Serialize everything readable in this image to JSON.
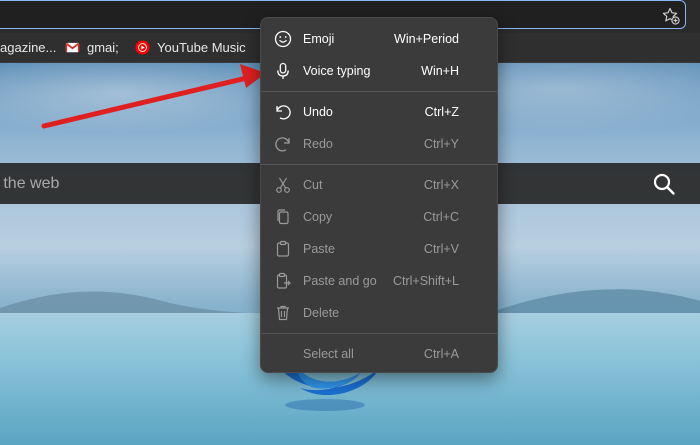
{
  "bookmarks": [
    {
      "label": "agazine...",
      "icon": "bookmark-icon"
    },
    {
      "label": "gmai;",
      "icon": "gmail-icon"
    },
    {
      "label": "YouTube Music",
      "icon": "youtube-music-icon"
    }
  ],
  "search": {
    "placeholder": "h the web"
  },
  "menu": {
    "items": [
      {
        "label": "Emoji",
        "shortcut": "Win+Period",
        "icon": "emoji-icon",
        "enabled": true
      },
      {
        "label": "Voice typing",
        "shortcut": "Win+H",
        "icon": "microphone-icon",
        "enabled": true
      },
      {
        "label": "Undo",
        "shortcut": "Ctrl+Z",
        "icon": "undo-icon",
        "enabled": true
      },
      {
        "label": "Redo",
        "shortcut": "Ctrl+Y",
        "icon": "redo-icon",
        "enabled": false
      },
      {
        "label": "Cut",
        "shortcut": "Ctrl+X",
        "icon": "scissors-icon",
        "enabled": false
      },
      {
        "label": "Copy",
        "shortcut": "Ctrl+C",
        "icon": "copy-icon",
        "enabled": false
      },
      {
        "label": "Paste",
        "shortcut": "Ctrl+V",
        "icon": "paste-icon",
        "enabled": false
      },
      {
        "label": "Paste and go",
        "shortcut": "Ctrl+Shift+L",
        "icon": "paste-and-go-icon",
        "enabled": false
      },
      {
        "label": "Delete",
        "shortcut": "",
        "icon": "trash-icon",
        "enabled": false
      },
      {
        "label": "Select all",
        "shortcut": "Ctrl+A",
        "icon": "",
        "enabled": false
      }
    ]
  },
  "colors": {
    "annotation_arrow": "#e02020",
    "focus_outline": "#8ab4f8",
    "menu_bg": "#3b3b3b"
  }
}
